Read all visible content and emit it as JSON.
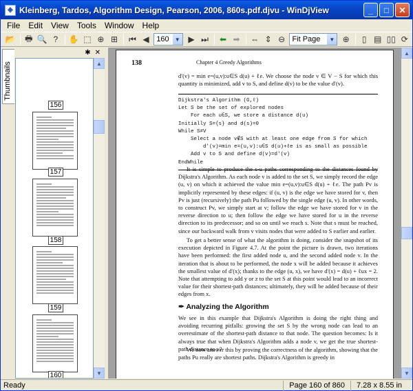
{
  "window": {
    "title": "Kleinberg, Tardos, Algorithm Design, Pearson, 2006, 860s.pdf.djvu - WinDjView",
    "buttons": {
      "minimize": "_",
      "maximize": "□",
      "close": "✕"
    }
  },
  "menu": [
    "File",
    "Edit",
    "View",
    "Tools",
    "Window",
    "Help"
  ],
  "toolbar": {
    "page_value": "160",
    "zoom_value": "Fit Page"
  },
  "sidebar": {
    "tab_label": "Thumbnails",
    "pin_icon": "✱",
    "close_icon": "✕",
    "thumbnails": [
      "156",
      "157",
      "158",
      "159",
      "160"
    ]
  },
  "document": {
    "page_number": "138",
    "chapter_header": "Chapter 4   Greedy Algorithms",
    "intro": "d′(v) = min e=(u,v):u∈S d(u) + ℓe. We choose the node v ∈ V − S for which this quantity is minimized, add v to S, and define d(v) to be the value d′(v).",
    "algorithm": "Dijkstra's Algorithm (G,ℓ)\nLet S be the set of explored nodes\n    For each u∈S, we store a distance d(u)\nInitially S={s} and d(s)=0\nWhile S≠V\n    Select a node v∉S with at least one edge from S for which\n        d′(v)=min e=(u,v):u∈S d(u)+ℓe is as small as possible\n    Add v to S and define d(v)=d′(v)\nEndWhile",
    "para1": "It is simple to produce the s-u paths corresponding to the distances found by Dijkstra's Algorithm. As each node v is added to the set S, we simply record the edge (u, v) on which it achieved the value min e=(u,v):u∈S d(u) + ℓe. The path Pv is implicitly represented by these edges: if (u, v) is the edge we have stored for v, then Pv is just (recursively) the path Pu followed by the single edge (u, v). In other words, to construct Pv, we simply start at v; follow the edge we have stored for v in the reverse direction to u; then follow the edge we have stored for u in the reverse direction to its predecessor; and so on until we reach s. Note that s must be reached, since our backward walk from v visits nodes that were added to S earlier and earlier.",
    "para2": "To get a better sense of what the algorithm is doing, consider the snapshot of its execution depicted in Figure 4.7. At the point the picture is drawn, two iterations have been performed: the first added node u, and the second added node v. In the iteration that is about to be performed, the node x will be added because it achieves the smallest value of d′(x); thanks to the edge (u, x), we have d′(x) = d(u) + ℓux = 2. Note that attempting to add y or z to the set S at this point would lead to an incorrect value for their shortest-path distances; ultimately, they will be added because of their edges from x.",
    "section_title": "Analyzing the Algorithm",
    "para3": "We see in this example that Dijkstra's Algorithm is doing the right thing and avoiding recurring pitfalls: growing the set S by the wrong node can lead to an overestimate of the shortest-path distance to that node. The question becomes: Is it always true that when Dijkstra's Algorithm adds a node v, we get the true shortest-path distance to v?",
    "para4": "We now answer this by proving the correctness of the algorithm, showing that the paths Pu really are shortest paths. Dijkstra's Algorithm is greedy in"
  },
  "status": {
    "text": "Ready",
    "page": "Page 160 of 860",
    "size": "7.28 x 8.55 in"
  }
}
